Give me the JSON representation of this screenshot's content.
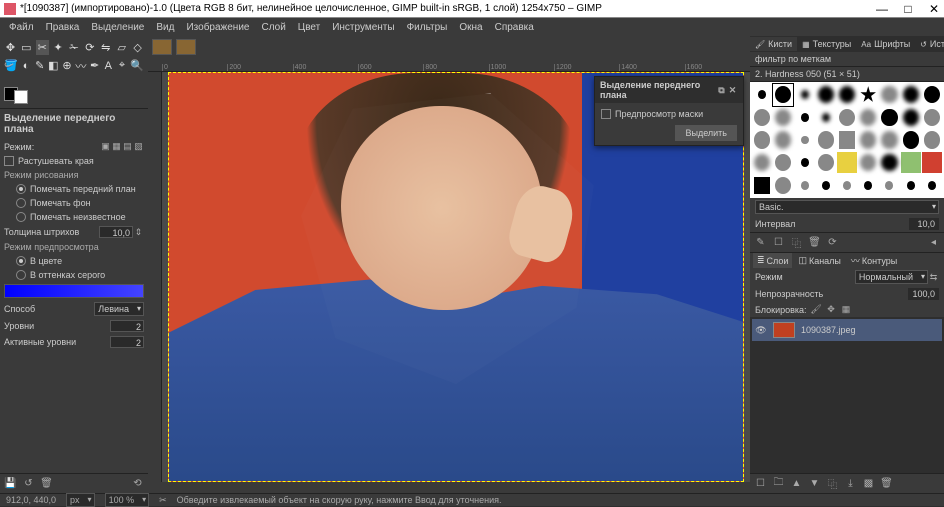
{
  "window": {
    "title": "*[1090387] (импортировано)-1.0 (Цвета RGB 8 бит, нелинейное целочисленное, GIMP built-in sRGB, 1 слой) 1254x750 – GIMP",
    "minimize": "—",
    "maximize": "□",
    "close": "✕"
  },
  "menu": [
    "Файл",
    "Правка",
    "Выделение",
    "Вид",
    "Изображение",
    "Слой",
    "Цвет",
    "Инструменты",
    "Фильтры",
    "Окна",
    "Справка"
  ],
  "toolOptions": {
    "title": "Выделение переднего плана",
    "mode_label": "Режим:",
    "feather": "Растушевать края",
    "drawmode_label": "Режим рисования",
    "draw_fg": "Помечать передний план",
    "draw_bg": "Помечать фон",
    "draw_unknown": "Помечать неизвестное",
    "stroke_width_label": "Толщина штрихов",
    "stroke_width_value": "10,0",
    "preview_mode_label": "Режим предпросмотра",
    "preview_color": "В цвете",
    "preview_gray": "В оттенках серого",
    "engine_label": "Способ",
    "engine_value": "Левина",
    "levels_label": "Уровни",
    "levels_value": "2",
    "active_levels_label": "Активные уровни",
    "active_levels_value": "2"
  },
  "floatingDialog": {
    "title": "Выделение переднего плана",
    "preview_mask": "Предпросмотр маски",
    "select_btn": "Выделить"
  },
  "rightTabs": {
    "brushes": "Кисти",
    "textures": "Текстуры",
    "fonts": "Шрифты",
    "history": "История"
  },
  "brushHeader": "2. Hardness 050 (51 × 51)",
  "brushFilter": "фильтр по меткам",
  "brushPreset": "Basic.",
  "interval_label": "Интервал",
  "interval_value": "10,0",
  "layersTabs": {
    "layers": "Слои",
    "channels": "Каналы",
    "paths": "Контуры"
  },
  "layerProps": {
    "mode_label": "Режим",
    "mode_value": "Нормальный",
    "opacity_label": "Непрозрачность",
    "opacity_value": "100,0",
    "lock_label": "Блокировка:"
  },
  "layer": {
    "name": "1090387.jpeg"
  },
  "status": {
    "coords": "912,0, 440,0",
    "unit": "px",
    "zoom": "100 %",
    "hint": "Обведите извлекаемый объект на скорую руку, нажмите Ввод для уточнения."
  },
  "ruler": [
    "0",
    "200",
    "400",
    "600",
    "800",
    "1000",
    "1200",
    "1400",
    "1600"
  ]
}
